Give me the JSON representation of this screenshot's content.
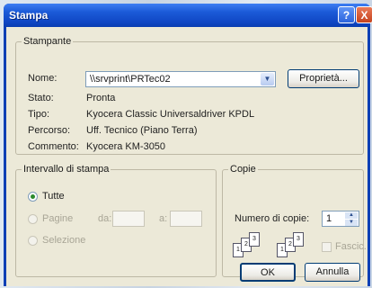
{
  "window": {
    "title": "Stampa",
    "help": "?",
    "close": "X"
  },
  "printer": {
    "group_label": "Stampante",
    "name_label": "Nome:",
    "name_value": "\\\\srvprint\\PRTec02",
    "properties_button": "Proprietà...",
    "status_label": "Stato:",
    "status_value": "Pronta",
    "type_label": "Tipo:",
    "type_value": "Kyocera Classic Universaldriver KPDL",
    "location_label": "Percorso:",
    "location_value": "Uff. Tecnico (Piano Terra)",
    "comment_label": "Commento:",
    "comment_value": "Kyocera KM-3050"
  },
  "range": {
    "group_label": "Intervallo di stampa",
    "all_label": "Tutte",
    "pages_label": "Pagine",
    "from_label": "da:",
    "to_label": "a:",
    "selection_label": "Selezione"
  },
  "copies": {
    "group_label": "Copie",
    "count_label": "Numero di copie:",
    "count_value": "1",
    "collate_label": "Fascic.",
    "collate_pages": [
      "1",
      "2",
      "3"
    ]
  },
  "buttons": {
    "ok": "OK",
    "cancel": "Annulla"
  }
}
